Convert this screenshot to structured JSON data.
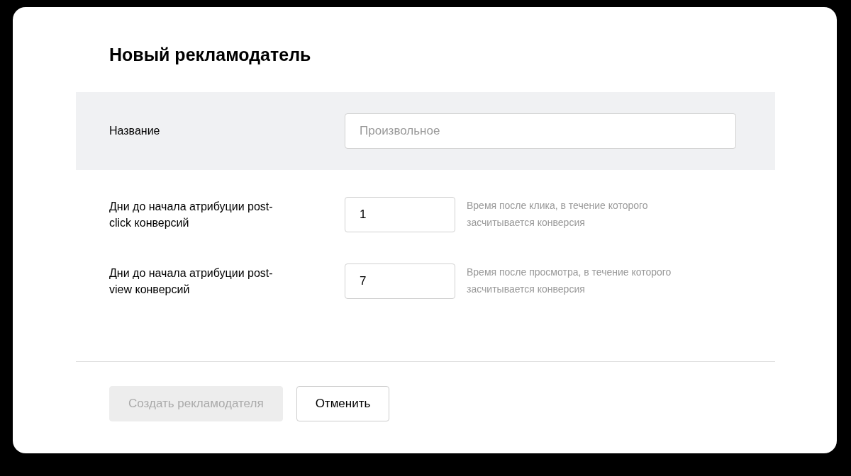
{
  "title": "Новый рекламодатель",
  "name_field": {
    "label": "Название",
    "placeholder": "Произвольное"
  },
  "fields": [
    {
      "label": "Дни до начала атрибуции post-click конверсий",
      "value": "1",
      "hint": "Время после клика, в течение которого засчитывается конверсия"
    },
    {
      "label": "Дни до начала атрибуции post-view конверсий",
      "value": "7",
      "hint": "Время после просмотра, в течение которого засчитывается конверсия"
    }
  ],
  "buttons": [
    {
      "label": "Создать рекламодателя",
      "disabled": true
    },
    {
      "label": "Отменить",
      "disabled": false
    }
  ]
}
